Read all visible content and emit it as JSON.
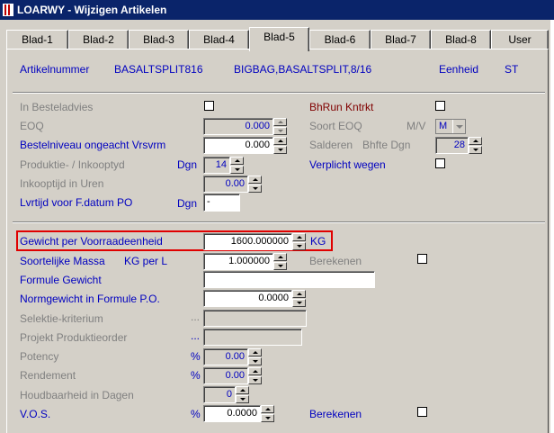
{
  "window": {
    "title": "LOARWY - Wijzigen Artikelen"
  },
  "tabs": [
    {
      "label": "Blad-1"
    },
    {
      "label": "Blad-2"
    },
    {
      "label": "Blad-3"
    },
    {
      "label": "Blad-4"
    },
    {
      "label": "Blad-5"
    },
    {
      "label": "Blad-6"
    },
    {
      "label": "Blad-7"
    },
    {
      "label": "Blad-8"
    },
    {
      "label": "User"
    }
  ],
  "active_tab": "Blad-5",
  "header": {
    "artikelnummer_label": "Artikelnummer",
    "artikelnummer_value": "BASALTSPLIT816",
    "omschrijving": "BIGBAG,BASALTSPLIT,8/16",
    "eenheid_label": "Eenheid",
    "eenheid_value": "ST"
  },
  "section1": {
    "in_besteladvies": {
      "label": "In Besteladvies",
      "checked": false
    },
    "bhrun": {
      "label": "BhRun Kntrkt",
      "checked": false
    },
    "eoq": {
      "label": "EOQ",
      "value": "0.000"
    },
    "soort_eoq": {
      "label": "Soort EOQ",
      "mv_label": "M/V",
      "mv_value": "M"
    },
    "bestelniveau": {
      "label": "Bestelniveau ongeacht Vrsvrm",
      "value": "0.000"
    },
    "salderen": {
      "label": "Salderen",
      "bhfte_label": "Bhfte Dgn",
      "bhfte_value": "28"
    },
    "produktie": {
      "label": "Produktie- / Inkooptyd",
      "unit": "Dgn",
      "value": "14"
    },
    "verplicht": {
      "label": "Verplicht wegen",
      "checked": false
    },
    "inkooptijd": {
      "label": "Inkooptijd in Uren",
      "value": "0.00"
    },
    "lvrtijd": {
      "label": "Lvrtijd voor F.datum PO",
      "unit": "Dgn",
      "value": "-"
    }
  },
  "section2": {
    "gewicht": {
      "label": "Gewicht per Voorraadeenheid",
      "value": "1600.000000",
      "unit": "KG"
    },
    "soortelijke": {
      "label": "Soortelijke Massa",
      "unit": "KG per L",
      "value": "1.000000",
      "berekenen_label": "Berekenen",
      "checked": false
    },
    "formule": {
      "label": "Formule Gewicht",
      "value": ""
    },
    "normgewicht": {
      "label": "Normgewicht in Formule P.O.",
      "value": "0.0000"
    },
    "selektie": {
      "label": "Selektie-kriterium",
      "dots": "...",
      "value": ""
    },
    "projekt": {
      "label": "Projekt Produktieorder",
      "dots": "...",
      "value": ""
    },
    "potency": {
      "label": "Potency",
      "unit": "%",
      "value": "0.00"
    },
    "rendement": {
      "label": "Rendement",
      "unit": "%",
      "value": "0.00"
    },
    "houdbaarheid": {
      "label": "Houdbaarheid in Dagen",
      "value": "0"
    },
    "vos": {
      "label": "V.O.S.",
      "unit": "%",
      "value": "0.0000",
      "berekenen_label": "Berekenen",
      "checked": false
    }
  }
}
